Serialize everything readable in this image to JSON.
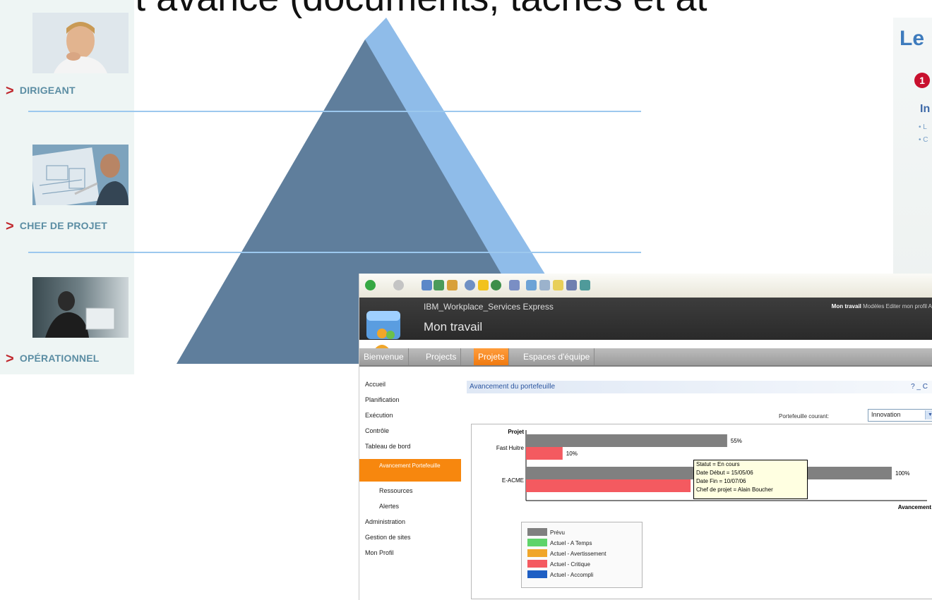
{
  "slide": {
    "headline": "Rapport avancé (documents, tâches et at"
  },
  "roles": [
    {
      "label": "DIRIGEANT",
      "arrow": ">"
    },
    {
      "label": "CHEF DE PROJET",
      "arrow": ">"
    },
    {
      "label": "OPÉRATIONNEL",
      "arrow": ">"
    }
  ],
  "background_slide": {
    "title_fragment": "Le",
    "step_number": "1",
    "heading_fragment": "In",
    "bullets": [
      "• L",
      "• C"
    ]
  },
  "browser": {
    "toolbar_icons": [
      "back-icon",
      "forward-icon",
      "stop-icon",
      "refresh-icon",
      "home-icon",
      "search-icon",
      "favorites-icon",
      "media-icon",
      "history-icon",
      "mail-icon",
      "print-icon",
      "edit-icon",
      "discuss-icon",
      "messenger-icon"
    ]
  },
  "app": {
    "brand": "IBM_Workplace_Services Express",
    "page_title": "Mon travail",
    "top_nav": {
      "current": "Mon travail",
      "links": [
        "Modèles",
        "Editer mon profil",
        "A"
      ]
    },
    "tabs": [
      {
        "label": "Bienvenue",
        "active": false
      },
      {
        "label": "Projects",
        "active": false
      },
      {
        "label": "Projets",
        "active": true
      },
      {
        "label": "Espaces d'équipe",
        "active": false
      }
    ],
    "sidenav": [
      {
        "label": "Accueil",
        "level": 0
      },
      {
        "label": "Planification",
        "level": 0
      },
      {
        "label": "Exécution",
        "level": 0
      },
      {
        "label": "Contrôle",
        "level": 0
      },
      {
        "label": "Tableau de bord",
        "level": 0
      },
      {
        "label": "Avancement Portefeuille",
        "level": 1,
        "active": true
      },
      {
        "label": "Ressources",
        "level": 1
      },
      {
        "label": "Alertes",
        "level": 1
      },
      {
        "label": "Administration",
        "level": 0
      },
      {
        "label": "Gestion de sites",
        "level": 0
      },
      {
        "label": "Mon Profil",
        "level": 0
      }
    ],
    "portlet": {
      "title": "Avancement du portefeuille",
      "controls": "? _ C",
      "portfolio_label": "Portefeuille courant:",
      "portfolio_value": "Innovation"
    },
    "tooltip": [
      "Statut = En cours",
      "Date Début = 15/05/06",
      "Date Fin = 10/07/06",
      "Chef de projet = Alain Boucher"
    ]
  },
  "colors": {
    "pyramid_front": "#5f7e9c",
    "pyramid_side": "#8fbce9",
    "divider": "#9cc8ee",
    "accent_orange": "#f7870e",
    "prevu": "#808080",
    "a_temps": "#5fd46a",
    "avertissement": "#f0a62a",
    "critique": "#f45a60",
    "accompli": "#1f5fc4"
  },
  "chart_data": {
    "type": "bar",
    "orientation": "horizontal",
    "ylabel": "Projet",
    "xlabel": "Avancement",
    "categories": [
      "Fast Huitre",
      "E-ACME"
    ],
    "series": [
      {
        "name": "Prévu",
        "color": "#808080",
        "values": [
          55,
          100
        ],
        "labels": [
          "55%",
          "100%"
        ]
      },
      {
        "name": "Actuel - Critique",
        "color": "#f45a60",
        "values": [
          10,
          45
        ],
        "labels": [
          "10%",
          ""
        ]
      }
    ],
    "xlim": [
      0,
      100
    ],
    "legend": [
      {
        "name": "Prévu",
        "color": "#808080"
      },
      {
        "name": "Actuel - A Temps",
        "color": "#5fd46a"
      },
      {
        "name": "Actuel - Avertissement",
        "color": "#f0a62a"
      },
      {
        "name": "Actuel - Critique",
        "color": "#f45a60"
      },
      {
        "name": "Actuel - Accompli",
        "color": "#1f5fc4"
      }
    ],
    "legend_placement": "bottom-left"
  }
}
